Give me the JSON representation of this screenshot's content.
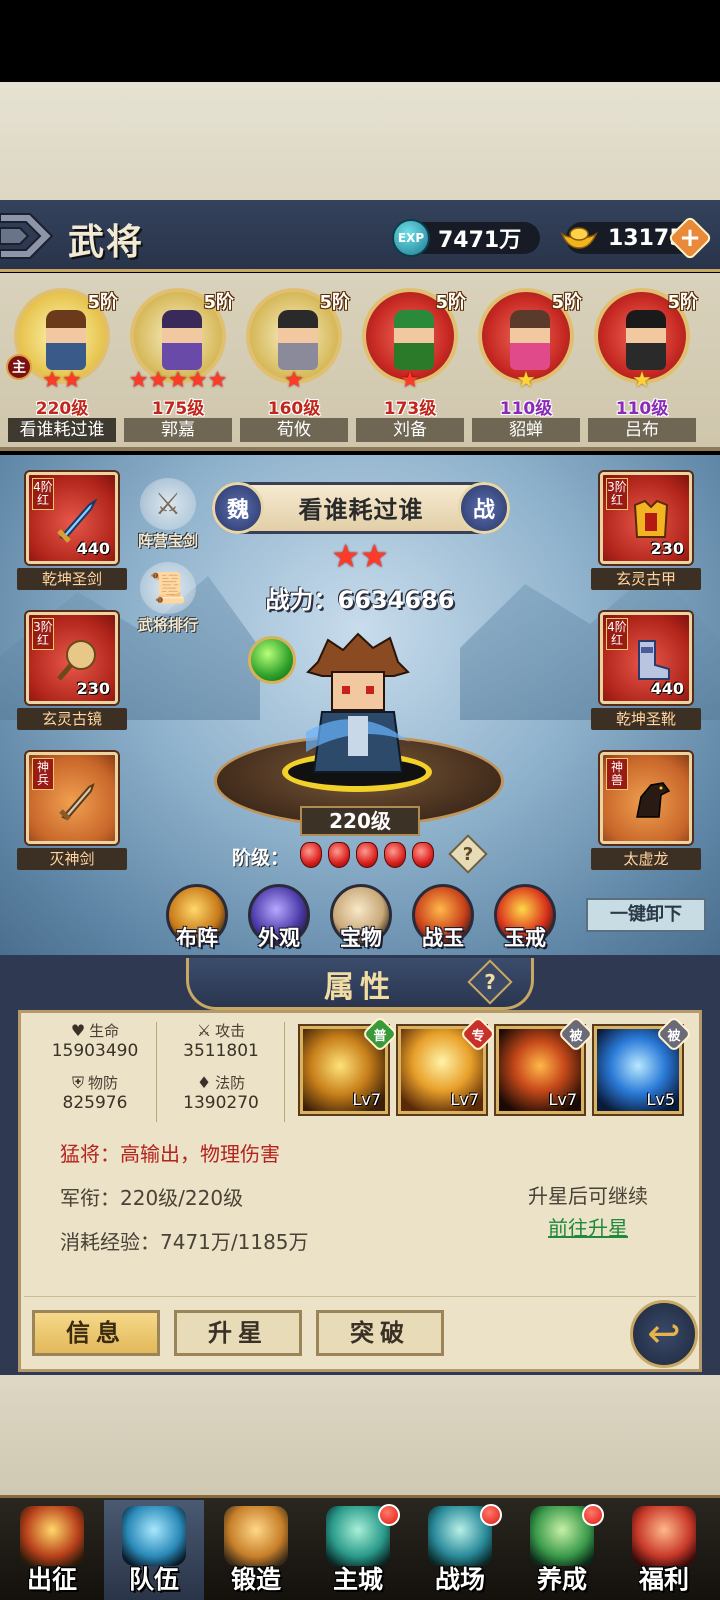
{
  "header": {
    "title": "武将",
    "exp_icon_label": "EXP",
    "exp_value": "7471万",
    "gold_value": "13175",
    "plus_label": "+"
  },
  "main_badge": "主",
  "heroes": [
    {
      "grade": "5阶",
      "stars": "★★",
      "star_color": "red",
      "level": "220级",
      "level_color": "red",
      "name": "看谁耗过谁",
      "frame": "gold",
      "active": true
    },
    {
      "grade": "5阶",
      "stars": "★★★★★",
      "star_color": "red",
      "level": "175级",
      "level_color": "red",
      "name": "郭嘉",
      "frame": "purple",
      "active": false
    },
    {
      "grade": "5阶",
      "stars": "★",
      "star_color": "red",
      "level": "160级",
      "level_color": "red",
      "name": "荀攸",
      "frame": "purple",
      "active": false
    },
    {
      "grade": "5阶",
      "stars": "★",
      "star_color": "red",
      "level": "173级",
      "level_color": "red",
      "name": "刘备",
      "frame": "red",
      "active": false
    },
    {
      "grade": "5阶",
      "stars": "★",
      "star_color": "gold",
      "level": "110级",
      "level_color": "purple",
      "name": "貂蝉",
      "frame": "red",
      "active": false
    },
    {
      "grade": "5阶",
      "stars": "★",
      "star_color": "gold",
      "level": "110级",
      "level_color": "purple",
      "name": "吕布",
      "frame": "red",
      "active": false
    }
  ],
  "equipment": {
    "weapon": {
      "tag": "4阶红",
      "value": "440",
      "name": "乾坤圣剑"
    },
    "armor": {
      "tag": "3阶红",
      "value": "230",
      "name": "玄灵古甲"
    },
    "mirror": {
      "tag": "3阶红",
      "value": "230",
      "name": "玄灵古镜"
    },
    "boots": {
      "tag": "4阶红",
      "value": "440",
      "name": "乾坤圣靴"
    },
    "divine_weapon": {
      "tag": "神兵",
      "name": "灭神剑"
    },
    "divine_beast": {
      "tag": "神兽",
      "name": "太虚龙"
    }
  },
  "side_buttons": {
    "camp_sword": "阵营宝剑",
    "ranking": "武将排行"
  },
  "selected_hero": {
    "faction": "魏",
    "war_badge": "战",
    "name": "看谁耗过谁",
    "stars": "★★",
    "power": "战力：6634686",
    "level": "220级",
    "rank_label": "阶级：",
    "rank_help": "?"
  },
  "action_menu": [
    {
      "label": "布阵"
    },
    {
      "label": "外观"
    },
    {
      "label": "宝物"
    },
    {
      "label": "战玉"
    },
    {
      "label": "玉戒"
    }
  ],
  "one_key_unequip": "一键卸下",
  "attributes": {
    "title": "属性",
    "help": "?",
    "stats": {
      "hp": {
        "name": "生命",
        "value": "15903490"
      },
      "atk": {
        "name": "攻击",
        "value": "3511801"
      },
      "pdef": {
        "name": "物防",
        "value": "825976"
      },
      "mdef": {
        "name": "法防",
        "value": "1390270"
      }
    },
    "skills": [
      {
        "tag": "普",
        "tag_color": "#3a9a3a",
        "level": "Lv7"
      },
      {
        "tag": "专",
        "tag_color": "#c8302a",
        "level": "Lv7"
      },
      {
        "tag": "被",
        "tag_color": "#6a6a78",
        "level": "Lv7"
      },
      {
        "tag": "被",
        "tag_color": "#6a6a78",
        "level": "Lv5"
      }
    ],
    "description": "猛将：高输出，物理伤害",
    "rank_info": "军衔：220级/220级",
    "exp_info": "消耗经验：7471万/1185万",
    "star_note": "升星后可继续",
    "go_star_link": "前往升星"
  },
  "tabs": [
    {
      "label": "信息",
      "active": true
    },
    {
      "label": "升星",
      "active": false
    },
    {
      "label": "突破",
      "active": false
    }
  ],
  "back_icon": "↩",
  "bottom_nav": [
    {
      "label": "出征",
      "active": false,
      "dot": false
    },
    {
      "label": "队伍",
      "active": true,
      "dot": false
    },
    {
      "label": "锻造",
      "active": false,
      "dot": false
    },
    {
      "label": "主城",
      "active": false,
      "dot": true
    },
    {
      "label": "战场",
      "active": false,
      "dot": true
    },
    {
      "label": "养成",
      "active": false,
      "dot": true
    },
    {
      "label": "福利",
      "active": false,
      "dot": false
    }
  ],
  "colors": {
    "header_bg": "#34425c",
    "accent_gold": "#c8a862",
    "panel_bg": "#ebe2c8",
    "desc_red": "#b4241e",
    "link_green": "#1e8a3a"
  }
}
